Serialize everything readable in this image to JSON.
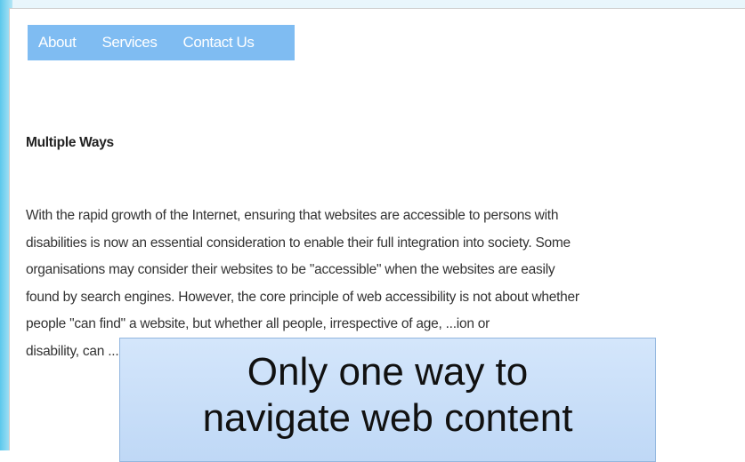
{
  "nav": {
    "items": [
      {
        "label": "About"
      },
      {
        "label": "Services"
      },
      {
        "label": "Contact Us"
      }
    ]
  },
  "content": {
    "heading": "Multiple Ways",
    "paragraph_lines": [
      "With the rapid growth of the Internet, ensuring that websites are accessible to persons with",
      "disabilities is now an essential consideration to enable their full integration into society. Some",
      "organisations may consider their websites to be \"accessible\" when the websites are easily",
      "found by search engines. However, the core principle of web accessibility is not about whether",
      "people \"can find\" a website, but whether all people, irrespective of age, ...ion or",
      "disability, can ..."
    ]
  },
  "callout": {
    "line1": "Only one way to",
    "line2": "navigate web content"
  },
  "colors": {
    "nav_bg": "#7fbcf2",
    "callout_bg": "#c9dff8",
    "slide_bg": "#bfe7f6"
  }
}
